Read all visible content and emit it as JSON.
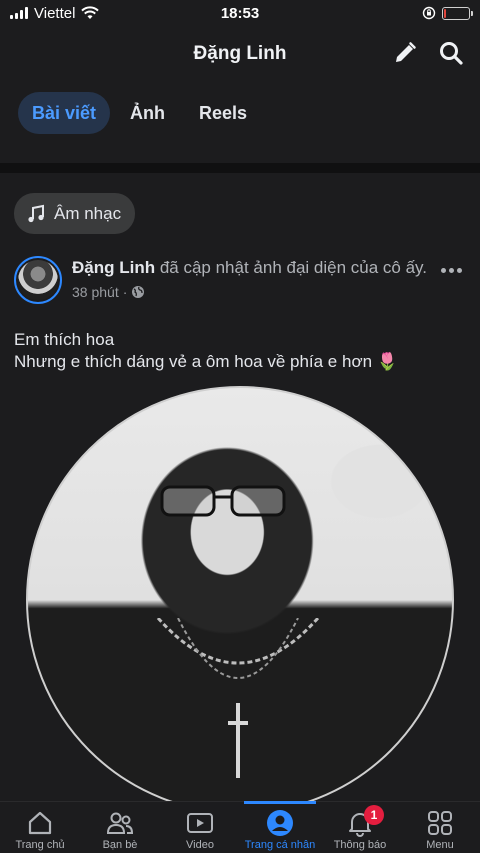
{
  "status_bar": {
    "carrier": "Viettel",
    "time": "18:53",
    "battery_level": 0.1
  },
  "header": {
    "title": "Đặng Linh",
    "edit_icon": "pencil-icon",
    "search_icon": "search-icon"
  },
  "tabs": [
    {
      "label": "Bài viết",
      "active": true
    },
    {
      "label": "Ảnh",
      "active": false
    },
    {
      "label": "Reels",
      "active": false
    }
  ],
  "music_chip": {
    "icon": "music-note-icon",
    "label": "Âm nhạc"
  },
  "post": {
    "author": "Đặng Linh",
    "action": " đã cập nhật ảnh đại diện của cô ấy.",
    "time": "38 phút",
    "separator": "·",
    "privacy_icon": "globe-icon",
    "text_line1": "Em thích hoa",
    "text_line2": "Nhưng e thích dáng vẻ a ôm hoa về phía e hơn 🌷"
  },
  "bottom_nav": [
    {
      "label": "Trang chủ",
      "icon": "home-icon"
    },
    {
      "label": "Bạn bè",
      "icon": "friends-icon"
    },
    {
      "label": "Video",
      "icon": "video-icon"
    },
    {
      "label": "Trang cá nhân",
      "icon": "profile-icon",
      "active": true
    },
    {
      "label": "Thông báo",
      "icon": "bell-icon",
      "badge": "1"
    },
    {
      "label": "Menu",
      "icon": "menu-grid-icon"
    }
  ],
  "colors": {
    "accent": "#2d88ff",
    "background": "#1c1c1e",
    "badge": "#e41e3f"
  }
}
